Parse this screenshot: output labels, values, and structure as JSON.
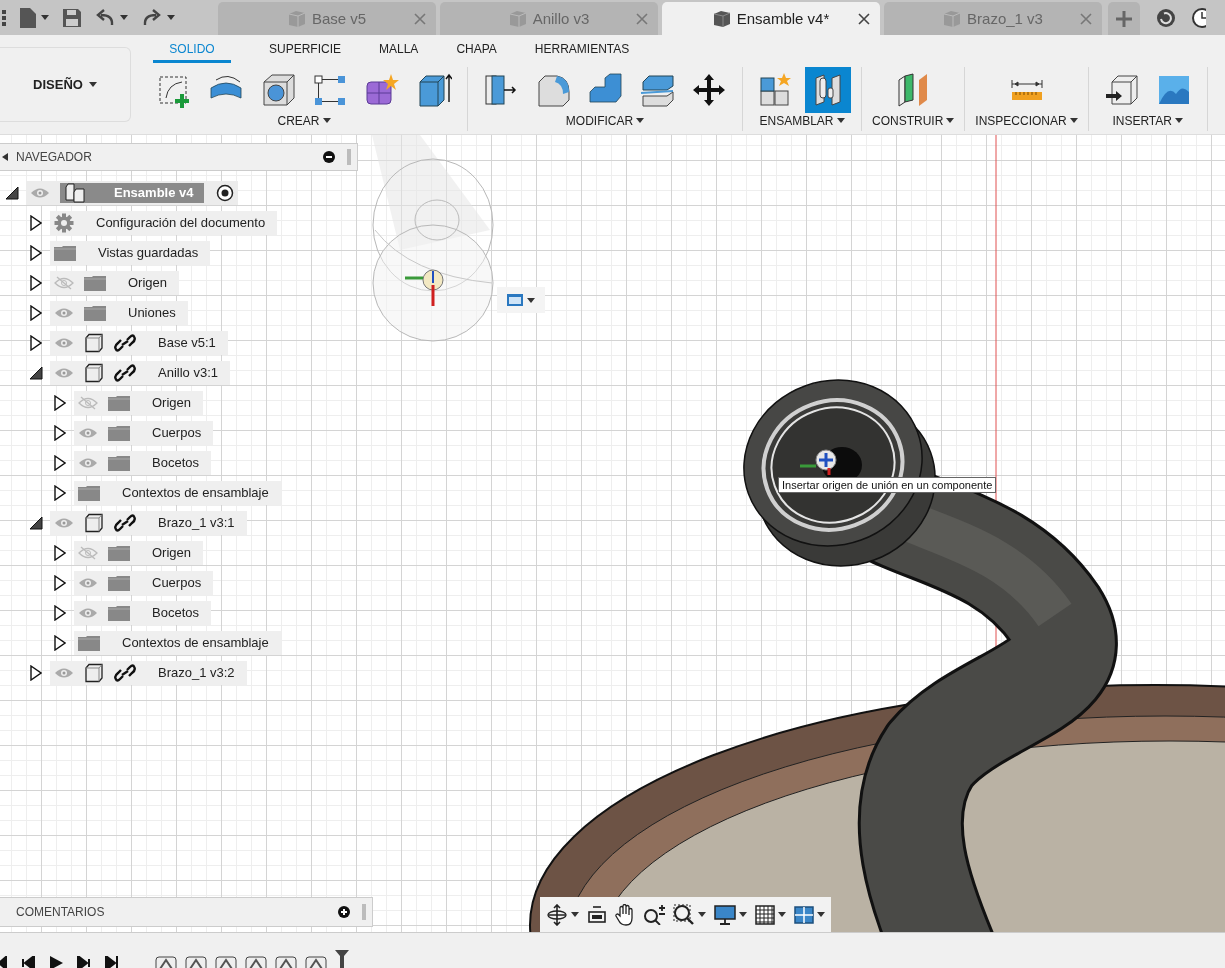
{
  "tabs": [
    {
      "label": "Base v5",
      "selected": false
    },
    {
      "label": "Anillo v3",
      "selected": false
    },
    {
      "label": "Ensamble v4*",
      "selected": true
    },
    {
      "label": "Brazo_1 v3",
      "selected": false
    }
  ],
  "workspace": "DISEÑO",
  "toolbar_tabs": [
    {
      "label": "SOLIDO",
      "selected": true
    },
    {
      "label": "SUPERFICIE",
      "selected": false
    },
    {
      "label": "MALLA",
      "selected": false
    },
    {
      "label": "CHAPA",
      "selected": false
    },
    {
      "label": "HERRAMIENTAS",
      "selected": false
    }
  ],
  "toolbar_groups": [
    {
      "label": "CREAR",
      "tools": [
        {
          "selected": false
        },
        {
          "selected": false
        },
        {
          "selected": false
        },
        {
          "selected": false
        },
        {
          "selected": false
        },
        {
          "selected": false
        }
      ]
    },
    {
      "label": "MODIFICAR",
      "tools": [
        {
          "selected": false
        },
        {
          "selected": false
        },
        {
          "selected": false
        },
        {
          "selected": false
        },
        {
          "selected": false
        }
      ]
    },
    {
      "label": "ENSAMBLAR",
      "tools": [
        {
          "selected": false
        },
        {
          "selected": true
        }
      ]
    },
    {
      "label": "CONSTRUIR",
      "tools": [
        {
          "selected": false
        }
      ]
    },
    {
      "label": "INSPECCIONAR",
      "tools": [
        {
          "selected": false
        }
      ]
    },
    {
      "label": "INSERTAR",
      "tools": [
        {
          "selected": false
        },
        {
          "selected": false
        }
      ]
    }
  ],
  "navigator": {
    "title": "NAVEGADOR",
    "tree": [
      {
        "label": "Ensamble v4",
        "kind": "assembly",
        "visible": true,
        "expanded": true,
        "selected": true,
        "active": true,
        "children": [
          {
            "label": "Configuración del documento",
            "kind": "settings",
            "expanded": false,
            "selected": false
          },
          {
            "label": "Vistas guardadas",
            "kind": "folder",
            "expanded": false,
            "selected": false
          },
          {
            "label": "Origen",
            "kind": "folder",
            "visible": false,
            "expanded": false,
            "selected": false
          },
          {
            "label": "Uniones",
            "kind": "folder",
            "visible": true,
            "expanded": false,
            "selected": false
          },
          {
            "label": "Base v5:1",
            "kind": "component",
            "visible": true,
            "linked": true,
            "expanded": false,
            "selected": false
          },
          {
            "label": "Anillo v3:1",
            "kind": "component",
            "visible": true,
            "linked": true,
            "expanded": true,
            "selected": false,
            "children": [
              {
                "label": "Origen",
                "kind": "folder",
                "visible": false,
                "expanded": false,
                "selected": false
              },
              {
                "label": "Cuerpos",
                "kind": "folder",
                "visible": true,
                "expanded": false,
                "selected": false
              },
              {
                "label": "Bocetos",
                "kind": "folder",
                "visible": true,
                "expanded": false,
                "selected": false
              },
              {
                "label": "Contextos de ensamblaje",
                "kind": "folder",
                "expanded": false,
                "selected": false
              }
            ]
          },
          {
            "label": "Brazo_1 v3:1",
            "kind": "component",
            "visible": true,
            "linked": true,
            "expanded": true,
            "selected": false,
            "children": [
              {
                "label": "Origen",
                "kind": "folder",
                "visible": false,
                "expanded": false,
                "selected": false
              },
              {
                "label": "Cuerpos",
                "kind": "folder",
                "visible": true,
                "expanded": false,
                "selected": false
              },
              {
                "label": "Bocetos",
                "kind": "folder",
                "visible": true,
                "expanded": false,
                "selected": false
              },
              {
                "label": "Contextos de ensamblaje",
                "kind": "folder",
                "expanded": false,
                "selected": false
              }
            ]
          },
          {
            "label": "Brazo_1 v3:2",
            "kind": "component",
            "visible": true,
            "linked": true,
            "expanded": false,
            "selected": false
          }
        ]
      }
    ]
  },
  "tooltip": "Insertar origen de unión en un componente",
  "comments": {
    "title": "COMENTARIOS"
  }
}
